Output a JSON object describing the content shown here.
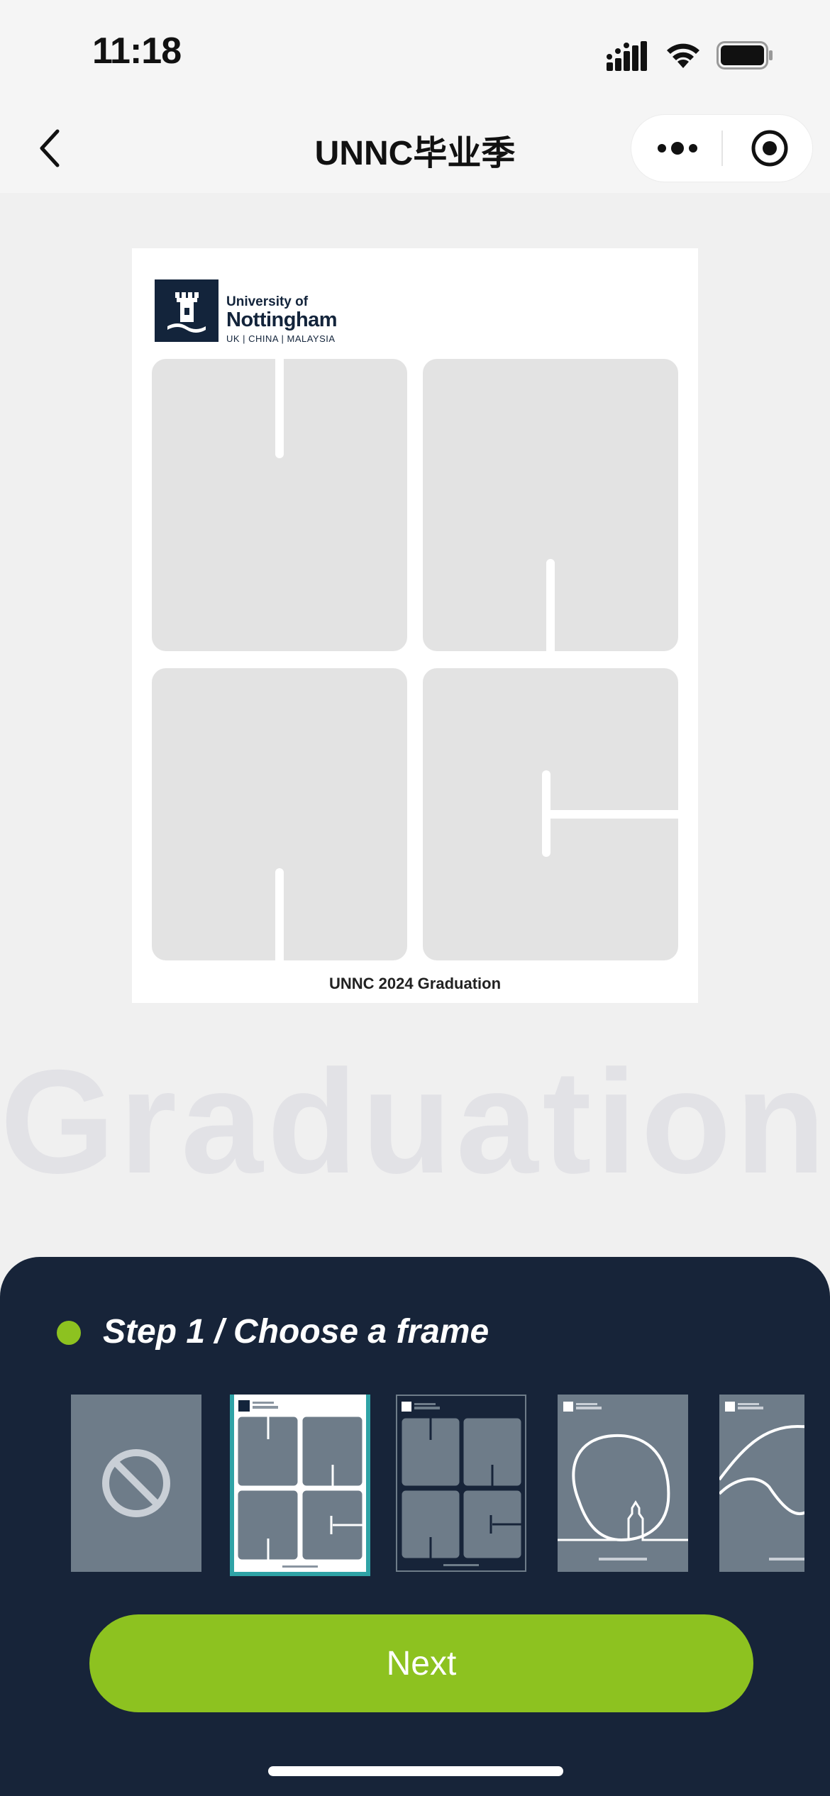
{
  "status_bar": {
    "time": "11:18",
    "icons": [
      "signal-icon",
      "wifi-icon",
      "battery-icon"
    ]
  },
  "nav": {
    "title": "UNNC毕业季",
    "back_icon": "chevron-left-icon",
    "more_icon": "more-icon",
    "close_icon": "target-close-icon"
  },
  "preview": {
    "logo": {
      "line1": "University of",
      "line2": "Nottingham",
      "line3": "UK | CHINA | MALAYSIA"
    },
    "caption": "UNNC 2024 Graduation"
  },
  "watermark": "Graduation",
  "panel": {
    "step_label": "Step 1 / Choose a frame",
    "frames": [
      {
        "name": "no-frame",
        "icon": "prohibited-icon"
      },
      {
        "name": "white-unnc-frame",
        "selected": true
      },
      {
        "name": "navy-unnc-frame"
      },
      {
        "name": "line-art-frame"
      },
      {
        "name": "curve-frame"
      }
    ],
    "next_label": "Next"
  },
  "colors": {
    "panel_bg": "#172439",
    "accent_green": "#8dc220",
    "selected_border": "#2fa3a6",
    "placeholder_gray": "#e3e3e3",
    "thumb_gray": "#6e7c89"
  }
}
